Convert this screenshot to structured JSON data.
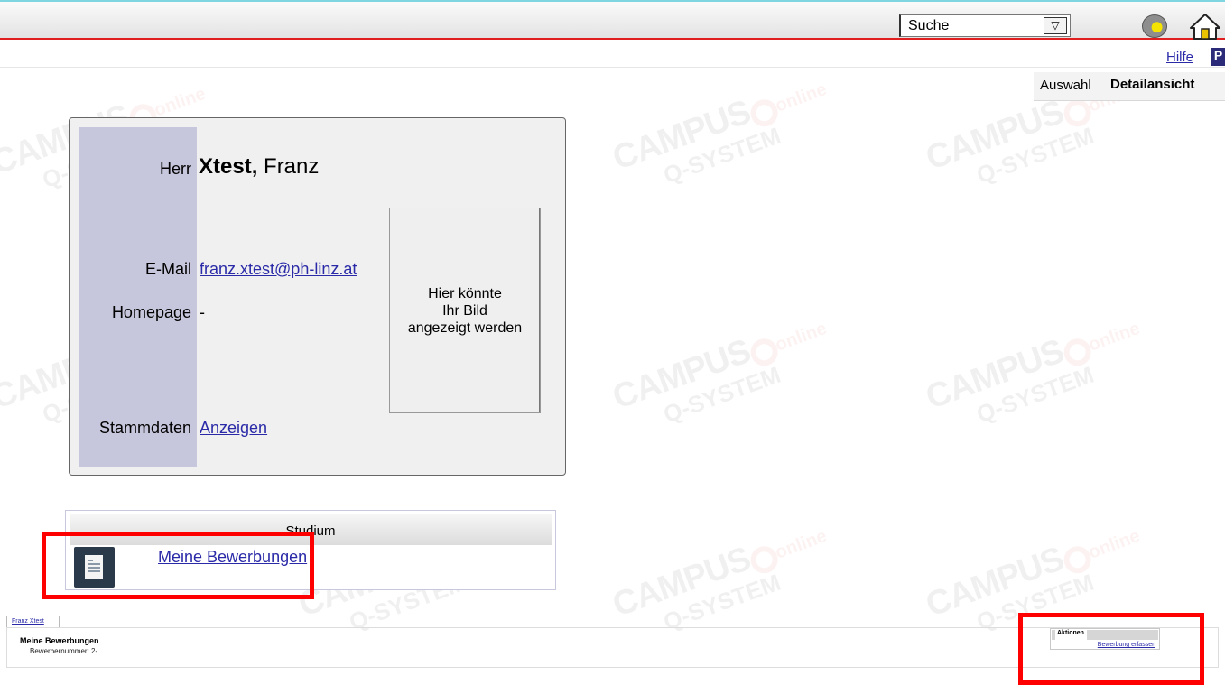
{
  "topbar": {
    "search_select_value": "Suche",
    "dropdown_glyph": "▽",
    "user_icon": "user-key-icon",
    "home_icon": "home-icon"
  },
  "subnav": {
    "help_link": "Hilfe",
    "extra_tab_initial": "P",
    "tab_selection": "Auswahl",
    "tab_detail": "Detailansicht"
  },
  "person": {
    "salutation": "Herr",
    "last_name": "Xtest,",
    "first_name": "Franz",
    "email_label": "E-Mail",
    "email": "franz.xtest@ph-linz.at",
    "homepage_label": "Homepage",
    "homepage_value": "-",
    "master_data_label": "Stammdaten",
    "master_data_link": "Anzeigen",
    "photo_placeholder": "Hier könnte\nIhr Bild\nangezeigt werden"
  },
  "studium": {
    "header": "Studium",
    "link": "Meine Bewerbungen",
    "icon": "application-document-icon"
  },
  "bottom": {
    "breadcrumb": "Franz Xtest",
    "title": "Meine Bewerbungen",
    "subtitle": "Bewerbernummer: 2-",
    "actions_title": "Aktionen",
    "actions_link": "Bewerbung erfassen"
  },
  "watermark": {
    "line1": "CAMPUS",
    "online": "online",
    "line2": "Q-SYSTEM"
  },
  "colors": {
    "highlight": "#ff0000",
    "link": "#2a2aa8",
    "label_column": "#c6c6dc"
  }
}
